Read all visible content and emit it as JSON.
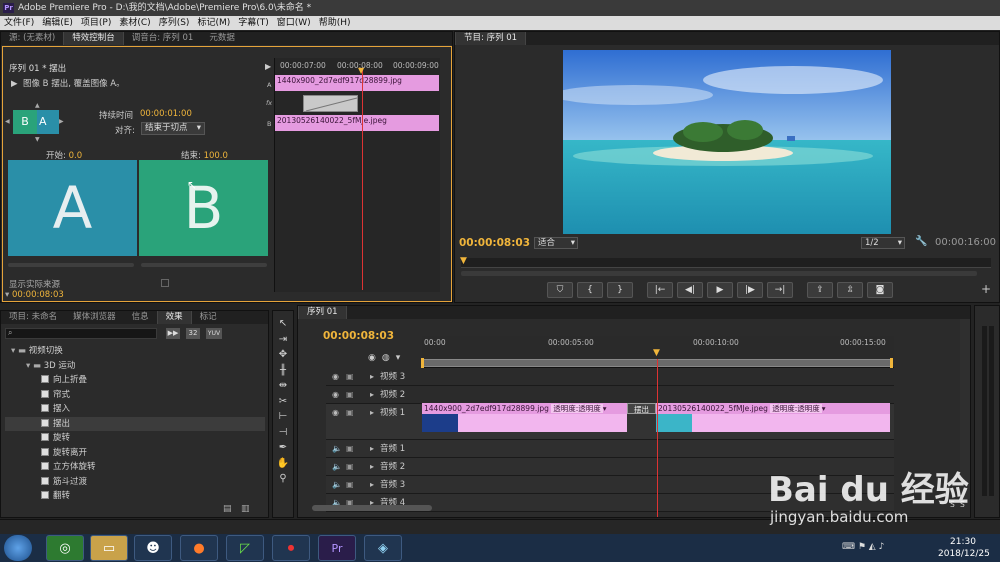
{
  "app": {
    "title": "Adobe Premiere Pro - D:\\我的文档\\Adobe\\Premiere Pro\\6.0\\未命名 *",
    "logo": "Pr"
  },
  "menu": [
    "文件(F)",
    "编辑(E)",
    "项目(P)",
    "素材(C)",
    "序列(S)",
    "标记(M)",
    "字幕(T)",
    "窗口(W)",
    "帮助(H)"
  ],
  "source_panel": {
    "tabs": [
      "源: (无素材)",
      "特效控制台",
      "调音台: 序列 01",
      "元数据"
    ],
    "sequence_label": "序列 01 * 摆出",
    "transition_desc": "图像 B 摆出, 覆盖图像 A。",
    "duration_label": "持续时间",
    "duration_value": "00:00:01:00",
    "align_label": "对齐:",
    "align_value": "结束于切点",
    "start_label": "开始:",
    "start_value": "0.0",
    "end_label": "结束:",
    "end_value": "100.0",
    "preview_a": "A",
    "preview_b": "B",
    "show_actual": "显示实际来源",
    "mini_ruler": [
      "00:00:07:00",
      "00:00:08:00",
      "00:00:09:00"
    ],
    "mini_clip_a": "1440x900_2d7edf917d28899.jpg",
    "mini_clip_b": "20130526140022_5fMJe.jpeg",
    "track_a": "A",
    "track_b": "B",
    "fx_label": "fx",
    "bottom_timecode": "00:00:08:03"
  },
  "program_panel": {
    "tab": "节目: 序列 01",
    "timecode": "00:00:08:03",
    "fit": "适合",
    "resolution": "1/2",
    "duration": "00:00:16:00"
  },
  "project_panel": {
    "tabs": [
      "项目: 未命名",
      "媒体浏览器",
      "信息",
      "效果",
      "标记"
    ],
    "search_placeholder": "",
    "tree": [
      {
        "label": "视频切换",
        "level": 0,
        "type": "folder"
      },
      {
        "label": "3D 运动",
        "level": 1,
        "type": "folder"
      },
      {
        "label": "向上折叠",
        "level": 2,
        "type": "item"
      },
      {
        "label": "帘式",
        "level": 2,
        "type": "item"
      },
      {
        "label": "摆入",
        "level": 2,
        "type": "item"
      },
      {
        "label": "摆出",
        "level": 2,
        "type": "item"
      },
      {
        "label": "旋转",
        "level": 2,
        "type": "item"
      },
      {
        "label": "旋转离开",
        "level": 2,
        "type": "item"
      },
      {
        "label": "立方体旋转",
        "level": 2,
        "type": "item"
      },
      {
        "label": "筋斗过渡",
        "level": 2,
        "type": "item"
      },
      {
        "label": "翻转",
        "level": 2,
        "type": "item"
      }
    ],
    "badges": [
      "32",
      "YUV"
    ]
  },
  "timeline": {
    "tab": "序列 01",
    "timecode": "00:00:08:03",
    "ruler": [
      "00:00",
      "00:00:05:00",
      "00:00:10:00",
      "00:00:15:00"
    ],
    "tracks": [
      {
        "name": "视频 3",
        "kind": "video"
      },
      {
        "name": "视频 2",
        "kind": "video"
      },
      {
        "name": "视频 1",
        "kind": "video"
      },
      {
        "name": "音频 1",
        "kind": "audio"
      },
      {
        "name": "音频 2",
        "kind": "audio"
      },
      {
        "name": "音频 3",
        "kind": "audio"
      },
      {
        "name": "音频 4",
        "kind": "audio"
      }
    ],
    "clip1_name": "1440x900_2d7edf917d28899.jpg",
    "clip1_fx": "透明度:透明度",
    "transition": "摆出",
    "clip2_name": "20130526140022_5fMJe.jpeg",
    "clip2_fx": "透明度:透明度",
    "s_labels": [
      "S",
      "S"
    ]
  },
  "taskbar": {
    "time": "21:30",
    "date": "2018/12/25",
    "icons": [
      "start",
      "360",
      "explorer",
      "qq",
      "firefox",
      "camtasia",
      "record",
      "premiere",
      "notes"
    ]
  },
  "watermark": {
    "brand": "Bai du 经验",
    "url": "jingyan.baidu.com"
  },
  "colors": {
    "accent": "#f0b53b",
    "clip": "#e59be0",
    "tile_a": "#2a8fa8",
    "tile_b": "#2aa37a"
  }
}
